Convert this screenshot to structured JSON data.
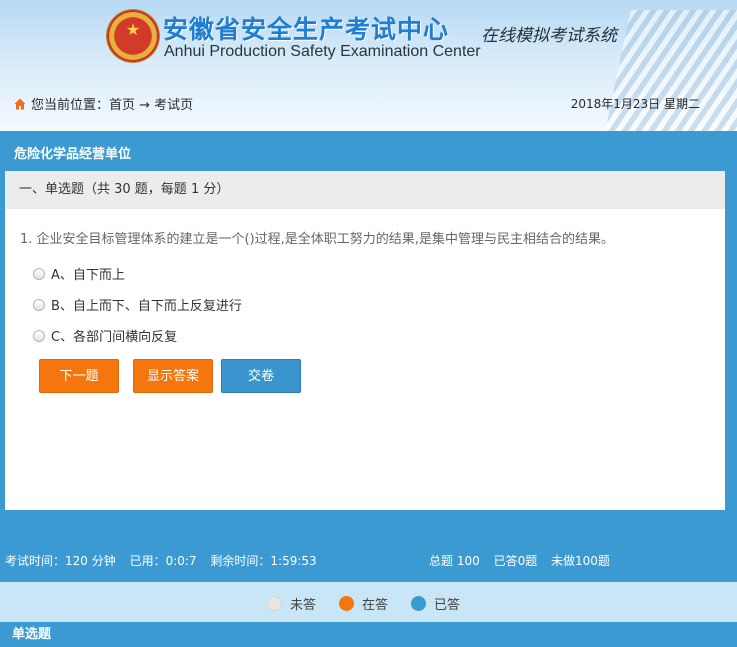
{
  "header": {
    "org_name_cn": "安徽省安全生产考试中心",
    "org_name_en": "Anhui Production Safety Examination Center",
    "system_name": "在线模拟考试系统",
    "emblem_icon": "national-emblem"
  },
  "breadcrumb": {
    "prefix": "您当前位置：首页 → 考试页",
    "icon": "home-icon"
  },
  "date": "2018年1月23日 星期二",
  "exam": {
    "category": "危险化学品经营单位",
    "section_heading": "一、单选题（共 30 题，每题 1 分）",
    "question": "1. 企业安全目标管理体系的建立是一个()过程,是全体职工努力的结果,是集中管理与民主相结合的结果。",
    "options": [
      "A、自下而上",
      "B、自上而下、自下而上反复进行",
      "C、各部门间横向反复"
    ],
    "buttons": {
      "next": "下一题",
      "show_answer": "显示答案",
      "submit": "交卷"
    }
  },
  "status": {
    "exam_time": "考试时间：120 分钟",
    "used": "已用：0:0:7",
    "remaining": "剩余时间：1:59:53",
    "total": "总题 100",
    "answered": "已答0题",
    "unanswered": "未做100题"
  },
  "legend": {
    "not_answered": "未答",
    "answering": "在答",
    "answered": "已答"
  },
  "colors": {
    "primary_blue": "#3b9ad2",
    "orange": "#f5760f",
    "legend_grey": "#e6e6e6",
    "legend_orange": "#f5760f",
    "legend_blue": "#3b9ad2"
  },
  "question_type_bar": "单选题"
}
